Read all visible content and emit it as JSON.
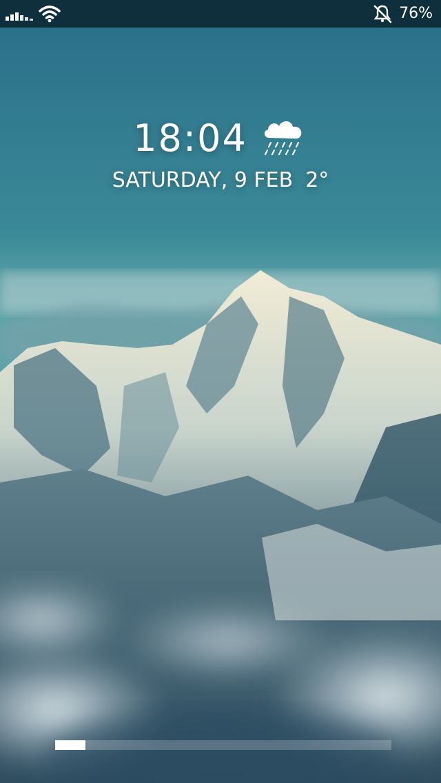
{
  "status_bar": {
    "signal_icon": "signal-bars-icon",
    "wifi_icon": "wifi-icon",
    "silent_icon": "bell-muted-icon",
    "battery_text": "76%"
  },
  "lock_screen": {
    "time": "18:04",
    "weather_icon": "rain-cloud-icon",
    "date": "SATURDAY, 9 FEB",
    "temperature": "2°"
  },
  "unlock_progress": {
    "fraction": 0.09
  },
  "colors": {
    "status_bar_bg": "#0f2f3d",
    "text": "#ffffff"
  }
}
